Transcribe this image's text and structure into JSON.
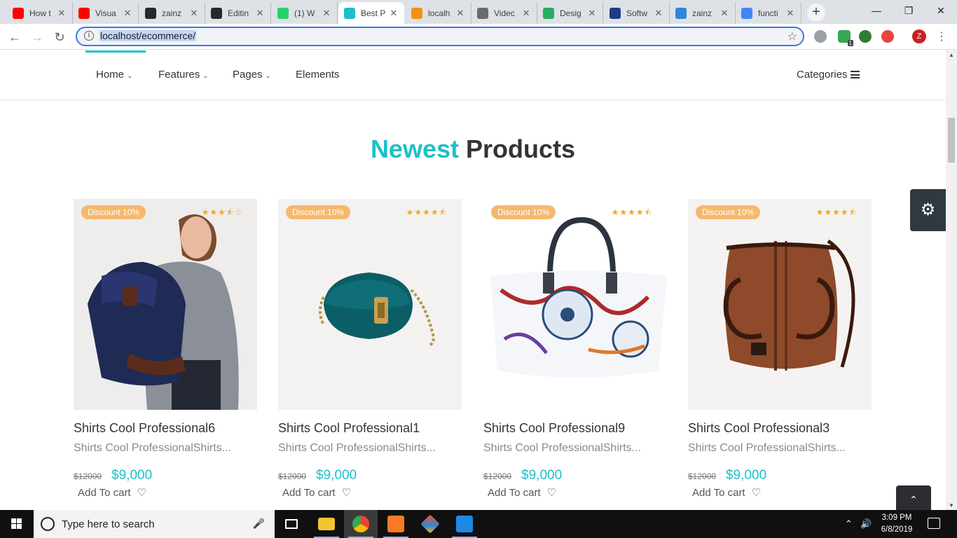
{
  "browser": {
    "tabs": [
      {
        "title": "How t",
        "icon": "youtube-icon",
        "color": "#ff0000"
      },
      {
        "title": "Visua",
        "icon": "youtube-icon",
        "color": "#ff0000"
      },
      {
        "title": "zainz",
        "icon": "github-icon",
        "color": "#24292e"
      },
      {
        "title": "Editin",
        "icon": "github-icon",
        "color": "#24292e"
      },
      {
        "title": "(1) W",
        "icon": "whatsapp-icon",
        "color": "#25d366"
      },
      {
        "title": "Best P",
        "icon": "lock-icon",
        "color": "#1cc0c8",
        "active": true
      },
      {
        "title": "localh",
        "icon": "phpmyadmin-icon",
        "color": "#f29111"
      },
      {
        "title": "Videc",
        "icon": "globe-icon",
        "color": "#6b6b6b"
      },
      {
        "title": "Desig",
        "icon": "design-icon",
        "color": "#27ae60"
      },
      {
        "title": "Softw",
        "icon": "software-icon",
        "color": "#1e3a8a"
      },
      {
        "title": "zainz",
        "icon": "fn-icon",
        "color": "#2f86d6"
      },
      {
        "title": "functi",
        "icon": "google-icon",
        "color": "#4285f4"
      }
    ],
    "close_glyph": "✕",
    "new_tab": "+",
    "url": "localhost/ecommerce/",
    "avatar_letter": "Z",
    "extension_badge": "1"
  },
  "site": {
    "nav": {
      "items": [
        {
          "label": "Home",
          "dropdown": true
        },
        {
          "label": "Features",
          "dropdown": true
        },
        {
          "label": "Pages",
          "dropdown": true
        },
        {
          "label": "Elements",
          "dropdown": false
        }
      ],
      "categories_label": "Categories"
    },
    "heading": {
      "accent": "Newest",
      "rest": "Products"
    },
    "products": [
      {
        "name": "Shirts Cool Professional6",
        "desc": "Shirts Cool ProfessionalShirts...",
        "badge": "Discount 10%",
        "old_price": "$12000",
        "price": "$9,000",
        "cart": "Add To cart",
        "rating": 3.5,
        "image": "backpack-model"
      },
      {
        "name": "Shirts Cool Professional1",
        "desc": "Shirts Cool ProfessionalShirts...",
        "badge": "Discount 10%",
        "old_price": "$12000",
        "price": "$9,000",
        "cart": "Add To cart",
        "rating": 4.5,
        "image": "teal-shoulder-bag"
      },
      {
        "name": "Shirts Cool Professional9",
        "desc": "Shirts Cool ProfessionalShirts...",
        "badge": "Discount 10%",
        "old_price": "$12000",
        "price": "$9,000",
        "cart": "Add To cart",
        "rating": 4.5,
        "image": "floral-tote-bag"
      },
      {
        "name": "Shirts Cool Professional3",
        "desc": "Shirts Cool ProfessionalShirts...",
        "badge": "Discount 10%",
        "old_price": "$12000",
        "price": "$9,000",
        "cart": "Add To cart",
        "rating": 4.5,
        "image": "brown-duffel-bag"
      }
    ],
    "accent_color": "#1cc0c8",
    "badge_color": "#f5b96e"
  },
  "taskbar": {
    "search_placeholder": "Type here to search",
    "time": "3:09 PM",
    "date": "6/8/2019",
    "pinned": [
      "task-view-icon",
      "file-explorer-icon",
      "chrome-icon",
      "xampp-icon",
      "git-icon",
      "vscode-icon"
    ]
  }
}
